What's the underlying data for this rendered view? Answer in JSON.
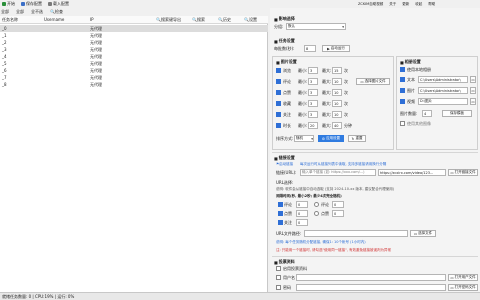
{
  "toolbar": {
    "start": "开始",
    "save_config": "保存配置",
    "load_config": "载入配置",
    "right_a": "ZCKIM自助视频",
    "right_b": "关于",
    "更新": "更新",
    "right_c": "收起",
    "right_d": "帮助"
  },
  "subbar": {
    "items": [
      "全部",
      "全部",
      "全不选",
      "检查"
    ]
  },
  "grid": {
    "headers": [
      "任务名称",
      "Username",
      "IP",
      "搜索键导出",
      "搜索",
      "历史",
      "设置"
    ],
    "rows": [
      {
        "name": "_0",
        "status": "无代理"
      },
      {
        "name": "_1",
        "status": "无代理"
      },
      {
        "name": "_2",
        "status": "无代理"
      },
      {
        "name": "_3",
        "status": "无代理"
      },
      {
        "name": "_4",
        "status": "无代理"
      },
      {
        "name": "_5",
        "status": "无代理"
      },
      {
        "name": "_6",
        "status": "无代理"
      },
      {
        "name": "_7",
        "status": "无代理"
      },
      {
        "name": "_8",
        "status": "无代理"
      }
    ]
  },
  "status": {
    "text": "就绪任务数量: 0 | CPU:19% | 运行: 0%"
  },
  "panel": {
    "title": "影响选择",
    "mode_label": "分组:",
    "mode_value": "默认",
    "random_section": "任务设置",
    "interval_label": "每批数(秒):",
    "interval_value": "8",
    "auto_run_label": "启动运行",
    "read_section": "图片设置",
    "rows": [
      {
        "label": "浏览",
        "min_label": "最小:",
        "min": "3",
        "max_label": "最大:",
        "max": "15",
        "unit": "次"
      },
      {
        "label": "评论",
        "min_label": "最小:",
        "min": "3",
        "max_label": "最大:",
        "max": "10",
        "unit": "次"
      },
      {
        "label": "点赞",
        "min_label": "最小:",
        "min": "3",
        "max_label": "最大:",
        "max": "10",
        "unit": "次"
      },
      {
        "label": "收藏",
        "min_label": "最小:",
        "min": "3",
        "max_label": "最大:",
        "max": "10",
        "unit": "次"
      },
      {
        "label": "关注",
        "min_label": "最小:",
        "min": "3",
        "max_label": "最大:",
        "max": "10",
        "unit": "次"
      },
      {
        "label": "时长",
        "min_label": "最小:",
        "min": "20",
        "max_label": "最大:",
        "max": "40",
        "unit": "分钟"
      }
    ],
    "pick_label": "选择图片文件",
    "sort_label": "排序方式:",
    "sort_value": "随机",
    "apply": "应用设置",
    "reset": "重置",
    "image_section": "相册设置",
    "use_local": "使用本地相册",
    "path_rows": [
      {
        "label": "文本",
        "value": "C:\\Users\\Administrator\\"
      },
      {
        "label": "图片",
        "value": "C:\\Users\\Administrator\\"
      },
      {
        "label": "视频",
        "value": "D:\\图片"
      }
    ],
    "count_label": "图片数量:",
    "count_value": "4",
    "save_tip": "使用其他图像",
    "save_btn": "保存模板",
    "link_section": "链接设置",
    "link_hint1": "启动链接",
    "link_hint2": "每次运行时从链接列表中读取, 支持多链接请用换行分隔",
    "link_label": "链接(URL):",
    "link_placeholder": "输入单个链接 (如: https://xxx.com/...)",
    "link_value": "https://zcxirx.com/video/123...",
    "link_btn": "打开链接文件",
    "url_section_label": "URL选择:",
    "url_note": "说明: 软件会从链接中自动选取 (支持 2024-10-xx 版本, 建议配合代理使用)",
    "interval_section": "间隔时间(秒, 最小2秒; 最少4次完全随机)",
    "opt_rows": [
      {
        "a": "评论",
        "av": "0",
        "b": "评论",
        "bv": "0"
      },
      {
        "a": "点赞",
        "av": "0",
        "b": "点赞",
        "bv": "0"
      },
      {
        "a": "关注",
        "av": "0"
      }
    ],
    "url_file_label": "URL文件路径:",
    "url_file_btn": "选择文件",
    "blue_tip": "说明: 每个任务随机分配链接, 确保1: 10个帐号 (1小时内)",
    "red_tip": "注: 只能用一个链接时, 请勾选\"使用同一链接\", 有效避免链接被误判为异常",
    "vote_section": "投票资料",
    "vote_opt": "启用投票资料",
    "vote_rows": [
      {
        "label": "用户名",
        "btn": "打开用户文件"
      },
      {
        "label": "密码",
        "btn": "打开密码文件"
      }
    ]
  }
}
